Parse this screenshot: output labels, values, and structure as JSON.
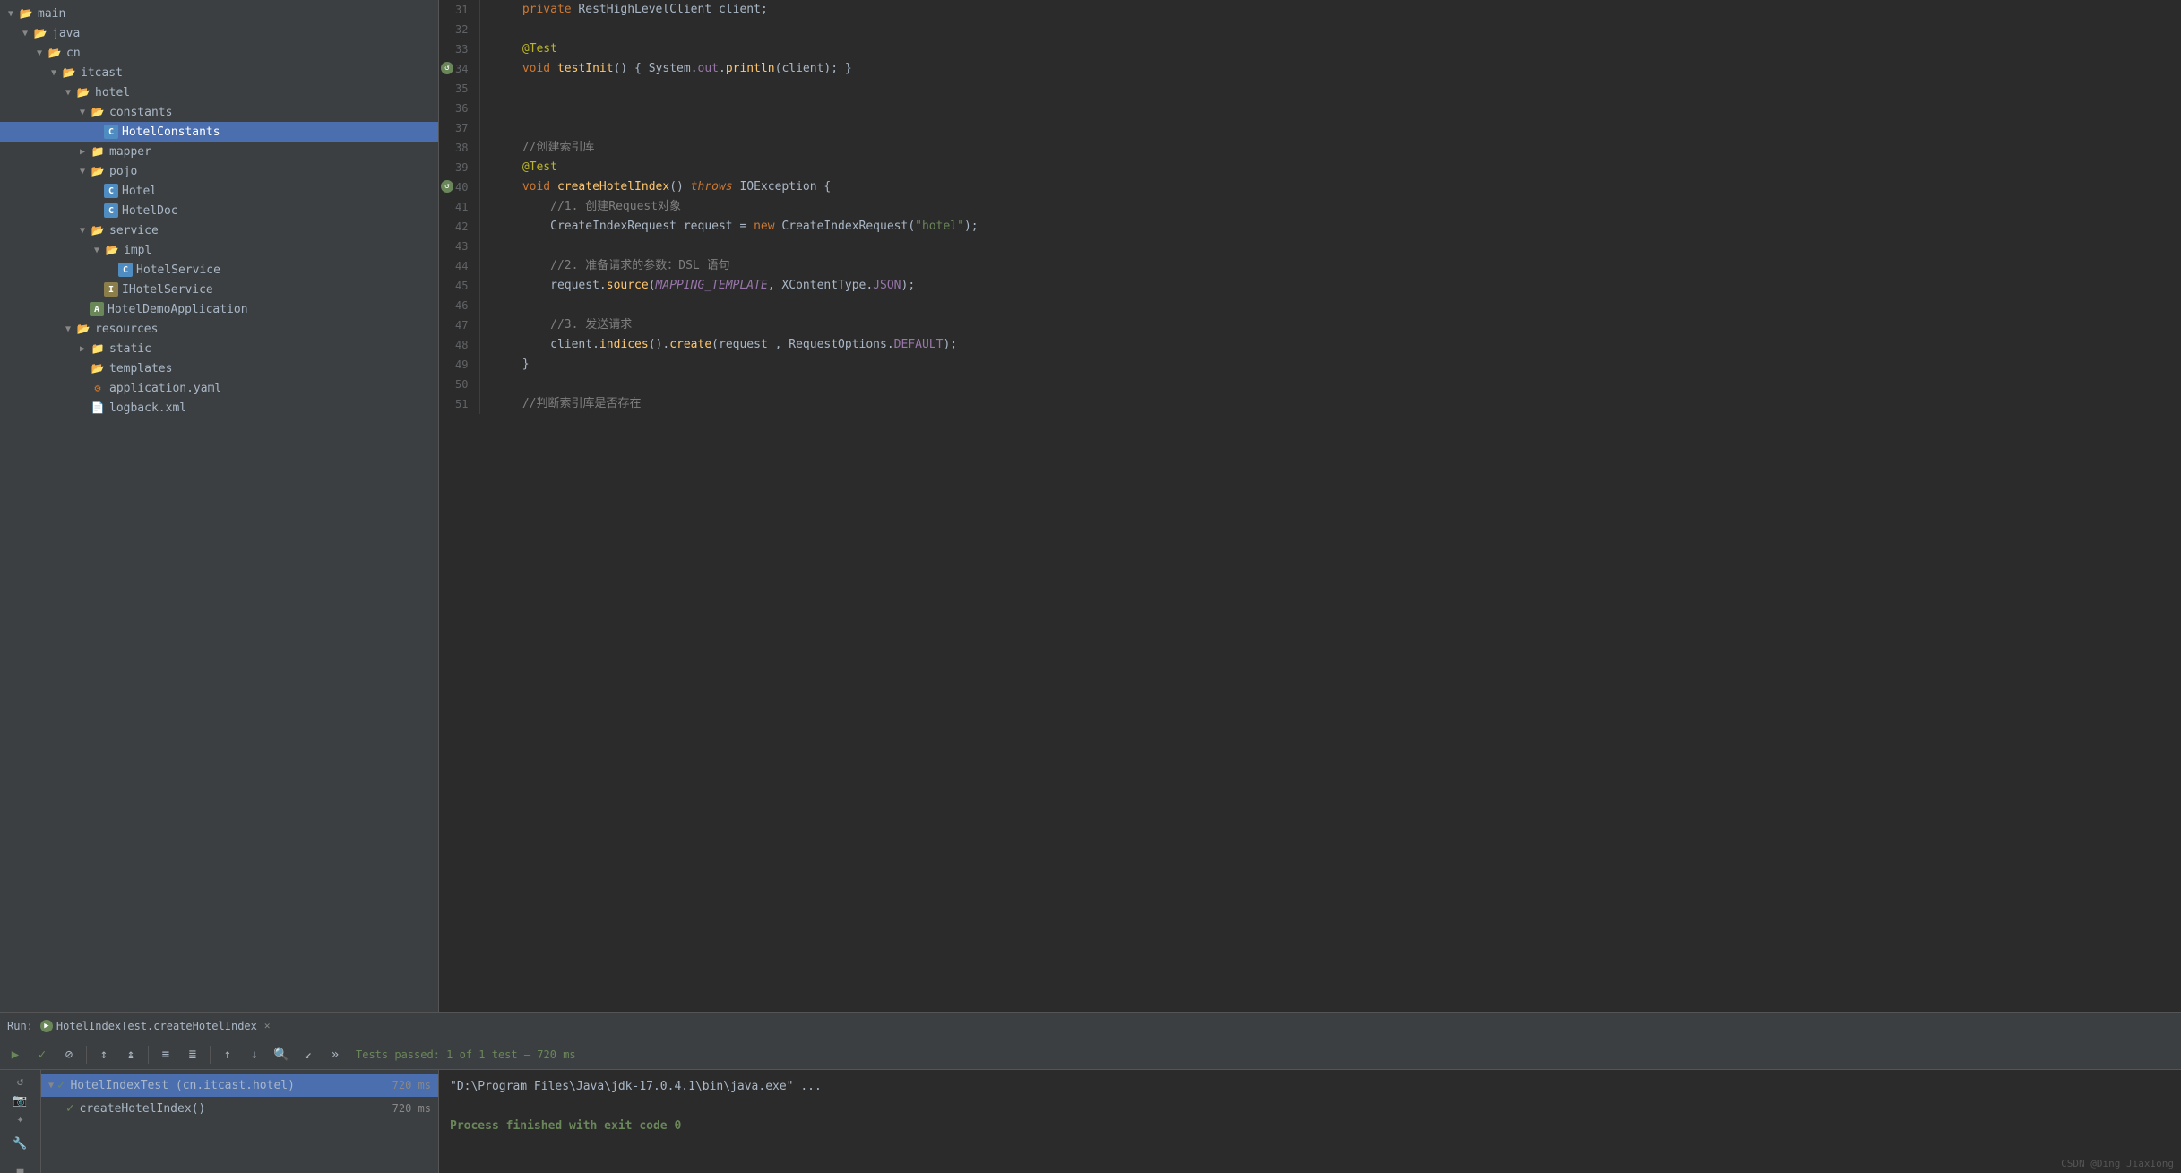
{
  "fileTree": {
    "items": [
      {
        "id": "main",
        "label": "main",
        "indent": 0,
        "type": "folder-open",
        "arrow": "▼"
      },
      {
        "id": "java",
        "label": "java",
        "indent": 1,
        "type": "folder-open",
        "arrow": "▼"
      },
      {
        "id": "cn",
        "label": "cn",
        "indent": 2,
        "type": "folder-open",
        "arrow": "▼"
      },
      {
        "id": "itcast",
        "label": "itcast",
        "indent": 3,
        "type": "folder-open",
        "arrow": "▼"
      },
      {
        "id": "hotel",
        "label": "hotel",
        "indent": 4,
        "type": "folder-open",
        "arrow": "▼"
      },
      {
        "id": "constants",
        "label": "constants",
        "indent": 5,
        "type": "folder-open",
        "arrow": "▼"
      },
      {
        "id": "HotelConstants",
        "label": "HotelConstants",
        "indent": 6,
        "type": "class-c",
        "arrow": "",
        "selected": true
      },
      {
        "id": "mapper",
        "label": "mapper",
        "indent": 5,
        "type": "folder-closed",
        "arrow": "▶"
      },
      {
        "id": "pojo",
        "label": "pojo",
        "indent": 5,
        "type": "folder-open",
        "arrow": "▼"
      },
      {
        "id": "Hotel",
        "label": "Hotel",
        "indent": 6,
        "type": "class-c",
        "arrow": ""
      },
      {
        "id": "HotelDoc",
        "label": "HotelDoc",
        "indent": 6,
        "type": "class-c",
        "arrow": ""
      },
      {
        "id": "service",
        "label": "service",
        "indent": 5,
        "type": "folder-open",
        "arrow": "▼"
      },
      {
        "id": "impl",
        "label": "impl",
        "indent": 6,
        "type": "folder-open",
        "arrow": "▼"
      },
      {
        "id": "HotelService",
        "label": "HotelService",
        "indent": 7,
        "type": "class-c",
        "arrow": ""
      },
      {
        "id": "IHotelService",
        "label": "IHotelService",
        "indent": 6,
        "type": "class-i",
        "arrow": ""
      },
      {
        "id": "HotelDemoApplication",
        "label": "HotelDemoApplication",
        "indent": 5,
        "type": "app",
        "arrow": ""
      },
      {
        "id": "resources",
        "label": "resources",
        "indent": 4,
        "type": "folder-open",
        "arrow": "▼"
      },
      {
        "id": "static",
        "label": "static",
        "indent": 5,
        "type": "folder-closed",
        "arrow": "▶"
      },
      {
        "id": "templates",
        "label": "templates",
        "indent": 5,
        "type": "folder-plain",
        "arrow": ""
      },
      {
        "id": "application.yaml",
        "label": "application.yaml",
        "indent": 5,
        "type": "yaml",
        "arrow": ""
      },
      {
        "id": "logback.xml",
        "label": "logback.xml",
        "indent": 5,
        "type": "xml",
        "arrow": ""
      }
    ]
  },
  "codeLines": [
    {
      "num": 31,
      "tokens": [
        {
          "t": "    ",
          "c": ""
        },
        {
          "t": "private",
          "c": "kw"
        },
        {
          "t": " RestHighLevelClient ",
          "c": "white"
        },
        {
          "t": "client",
          "c": "white"
        },
        {
          "t": ";",
          "c": "white"
        }
      ],
      "gutter": false
    },
    {
      "num": 32,
      "tokens": [],
      "gutter": false
    },
    {
      "num": 33,
      "tokens": [
        {
          "t": "    ",
          "c": ""
        },
        {
          "t": "@Test",
          "c": "annotation"
        }
      ],
      "gutter": false
    },
    {
      "num": 34,
      "tokens": [
        {
          "t": "    ",
          "c": ""
        },
        {
          "t": "void",
          "c": "kw"
        },
        {
          "t": " ",
          "c": ""
        },
        {
          "t": "testInit",
          "c": "fn"
        },
        {
          "t": "() { ",
          "c": "white"
        },
        {
          "t": "System",
          "c": "cls"
        },
        {
          "t": ".",
          "c": "white"
        },
        {
          "t": "out",
          "c": "field"
        },
        {
          "t": ".",
          "c": "white"
        },
        {
          "t": "println",
          "c": "fn"
        },
        {
          "t": "(client); }",
          "c": "white"
        }
      ],
      "gutter": true
    },
    {
      "num": 35,
      "tokens": [],
      "gutter": false
    },
    {
      "num": 36,
      "tokens": [],
      "gutter": false
    },
    {
      "num": 37,
      "tokens": [],
      "gutter": false
    },
    {
      "num": 38,
      "tokens": [
        {
          "t": "    ",
          "c": ""
        },
        {
          "t": "//创建索引库",
          "c": "comment-zh"
        }
      ],
      "gutter": false
    },
    {
      "num": 39,
      "tokens": [
        {
          "t": "    ",
          "c": ""
        },
        {
          "t": "@Test",
          "c": "annotation"
        }
      ],
      "gutter": false
    },
    {
      "num": 40,
      "tokens": [
        {
          "t": "    ",
          "c": ""
        },
        {
          "t": "void",
          "c": "kw"
        },
        {
          "t": " ",
          "c": ""
        },
        {
          "t": "createHotelIndex",
          "c": "fn"
        },
        {
          "t": "() ",
          "c": "white"
        },
        {
          "t": "throws",
          "c": "kw2"
        },
        {
          "t": " IOException {",
          "c": "white"
        }
      ],
      "gutter": true
    },
    {
      "num": 41,
      "tokens": [
        {
          "t": "        ",
          "c": ""
        },
        {
          "t": "//1. 创建Request对象",
          "c": "comment-zh"
        }
      ],
      "gutter": false
    },
    {
      "num": 42,
      "tokens": [
        {
          "t": "        ",
          "c": ""
        },
        {
          "t": "CreateIndexRequest",
          "c": "cls"
        },
        {
          "t": " request = ",
          "c": "white"
        },
        {
          "t": "new",
          "c": "kw"
        },
        {
          "t": " ",
          "c": ""
        },
        {
          "t": "CreateIndexRequest",
          "c": "cls"
        },
        {
          "t": "(",
          "c": "white"
        },
        {
          "t": "\"hotel\"",
          "c": "str"
        },
        {
          "t": ");",
          "c": "white"
        }
      ],
      "gutter": false
    },
    {
      "num": 43,
      "tokens": [],
      "gutter": false
    },
    {
      "num": 44,
      "tokens": [
        {
          "t": "        ",
          "c": ""
        },
        {
          "t": "//2. 准备请求的参数：DSL 语句",
          "c": "comment-zh"
        }
      ],
      "gutter": false
    },
    {
      "num": 45,
      "tokens": [
        {
          "t": "        ",
          "c": ""
        },
        {
          "t": "request",
          "c": "white"
        },
        {
          "t": ".",
          "c": "white"
        },
        {
          "t": "source",
          "c": "fn"
        },
        {
          "t": "(",
          "c": "white"
        },
        {
          "t": "MAPPING_TEMPLATE",
          "c": "const"
        },
        {
          "t": ", XContentType.",
          "c": "white"
        },
        {
          "t": "JSON",
          "c": "field"
        },
        {
          "t": ");",
          "c": "white"
        }
      ],
      "gutter": false
    },
    {
      "num": 46,
      "tokens": [],
      "gutter": false
    },
    {
      "num": 47,
      "tokens": [
        {
          "t": "        ",
          "c": ""
        },
        {
          "t": "//3. 发送请求",
          "c": "comment-zh"
        }
      ],
      "gutter": false
    },
    {
      "num": 48,
      "tokens": [
        {
          "t": "        ",
          "c": ""
        },
        {
          "t": "client",
          "c": "white"
        },
        {
          "t": ".",
          "c": "white"
        },
        {
          "t": "indices",
          "c": "fn"
        },
        {
          "t": "().",
          "c": "white"
        },
        {
          "t": "create",
          "c": "fn"
        },
        {
          "t": "(request , RequestOptions.",
          "c": "white"
        },
        {
          "t": "DEFAULT",
          "c": "field"
        },
        {
          "t": ");",
          "c": "white"
        }
      ],
      "gutter": false
    },
    {
      "num": 49,
      "tokens": [
        {
          "t": "    }",
          "c": "white"
        }
      ],
      "gutter": false
    },
    {
      "num": 50,
      "tokens": [],
      "gutter": false
    },
    {
      "num": 51,
      "tokens": [
        {
          "t": "    ",
          "c": ""
        },
        {
          "t": "//判断索引库是否存在",
          "c": "comment-zh"
        }
      ],
      "gutter": false
    }
  ],
  "runPanel": {
    "tabLabel": "Run:",
    "tabName": "HotelIndexTest.createHotelIndex",
    "testStatus": "Tests passed: 1 of 1 test – 720 ms",
    "testItems": [
      {
        "label": "HotelIndexTest (cn.itcast.hotel)",
        "time": "720 ms",
        "indent": 0,
        "selected": true
      },
      {
        "label": "createHotelIndex()",
        "time": "720 ms",
        "indent": 1,
        "selected": false
      }
    ],
    "consoleLine1": "\"D:\\Program Files\\Java\\jdk-17.0.4.1\\bin\\java.exe\" ...",
    "consoleLine2": "",
    "consoleLine3": "Process finished with exit code 0"
  },
  "toolbar": {
    "buttons": [
      "▶",
      "✓",
      "⊘",
      "↕",
      "↕2",
      "≡",
      "≡2",
      "↑",
      "↓",
      "🔍",
      "↙",
      "»"
    ]
  },
  "watermark": "CSDN @Ding_JiaxIong"
}
